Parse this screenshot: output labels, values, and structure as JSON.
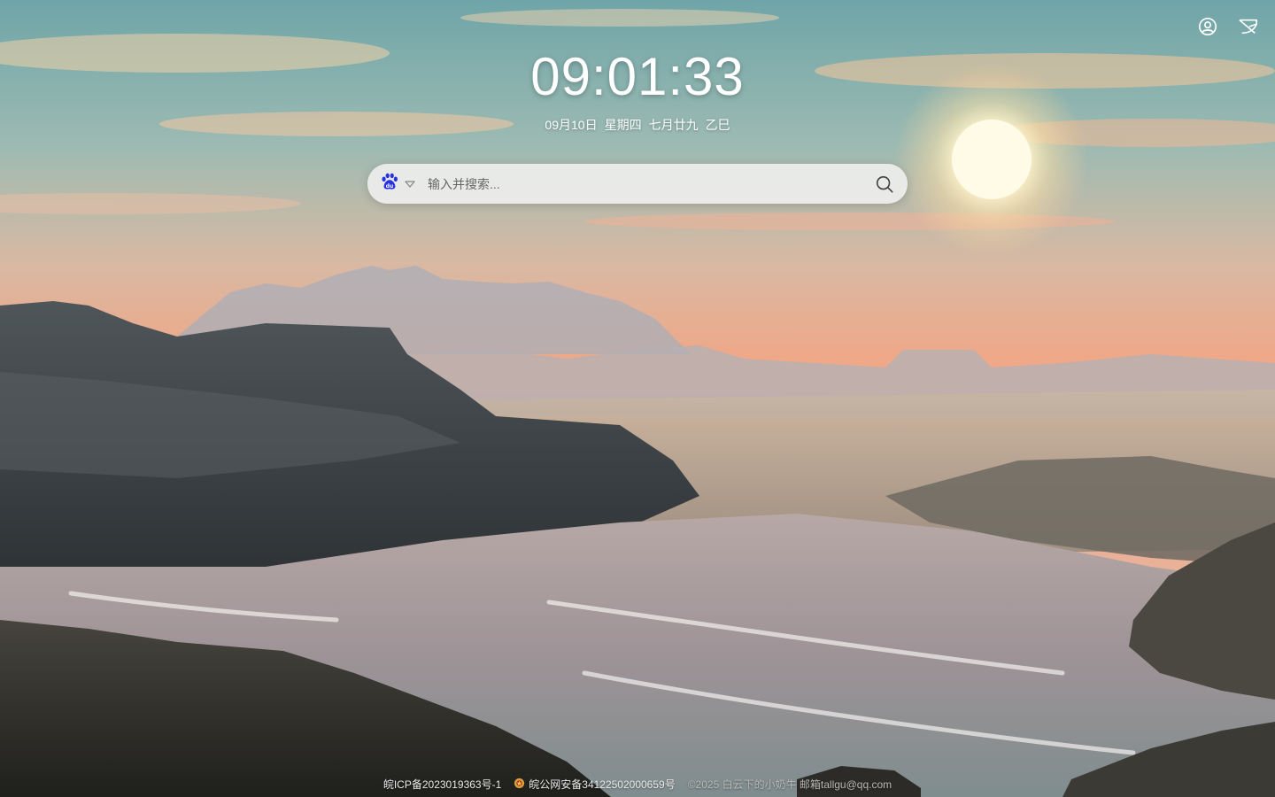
{
  "clock": {
    "time": "09:01:33"
  },
  "date": {
    "day": "09月10日",
    "weekday": "星期四",
    "lunar": "七月廿九",
    "ganzhi": "乙巳"
  },
  "search": {
    "placeholder": "输入并搜索...",
    "engine_icon": "baidu-paw-icon",
    "submit_icon": "search-icon"
  },
  "top_icons": {
    "account_icon": "user-circle-icon",
    "settings_icon": "feather-pen-icon"
  },
  "footer": {
    "icp": "皖ICP备2023019363号-1",
    "police": "皖公网安备34122502000659号",
    "copyright": "©2025 白云下的小奶牛 邮箱tallgu@qq.com"
  },
  "colors": {
    "baidu_blue": "#2932e1",
    "text_white": "#ffffff"
  }
}
